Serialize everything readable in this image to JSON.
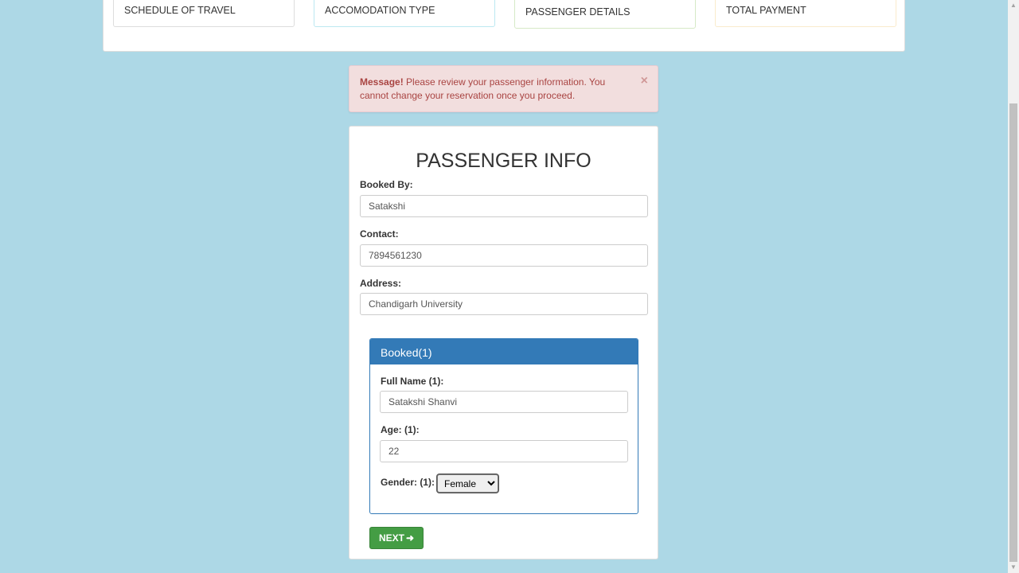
{
  "steps": [
    {
      "label": "SCHEDULE OF TRAVEL"
    },
    {
      "label": "ACCOMODATION TYPE"
    },
    {
      "label": "PASSENGER DETAILS"
    },
    {
      "label": "TOTAL PAYMENT"
    }
  ],
  "alert": {
    "strong": "Message!",
    "text": " Please review your passenger information. You cannot change your reservation once you proceed.",
    "close": "×"
  },
  "form": {
    "title": "PASSENGER INFO",
    "booked_by_label": "Booked By:",
    "booked_by_value": "Satakshi",
    "contact_label": "Contact:",
    "contact_value": "7894561230",
    "address_label": "Address:",
    "address_value": "Chandigarh University"
  },
  "passenger": {
    "heading": "Booked(1)",
    "full_name_label": "Full Name (1):",
    "full_name_value": "Satakshi Shanvi",
    "age_label": "Age: (1):",
    "age_value": "22",
    "gender_label": "Gender: (1):",
    "gender_selected": "Female"
  },
  "next_button": {
    "label": "NEXT",
    "icon": "arrow-right-icon"
  },
  "colors": {
    "background": "#add8e6",
    "alert_bg": "#f2dede",
    "alert_text": "#a94442",
    "panel_primary": "#337ab7",
    "button_success": "#449d44"
  }
}
